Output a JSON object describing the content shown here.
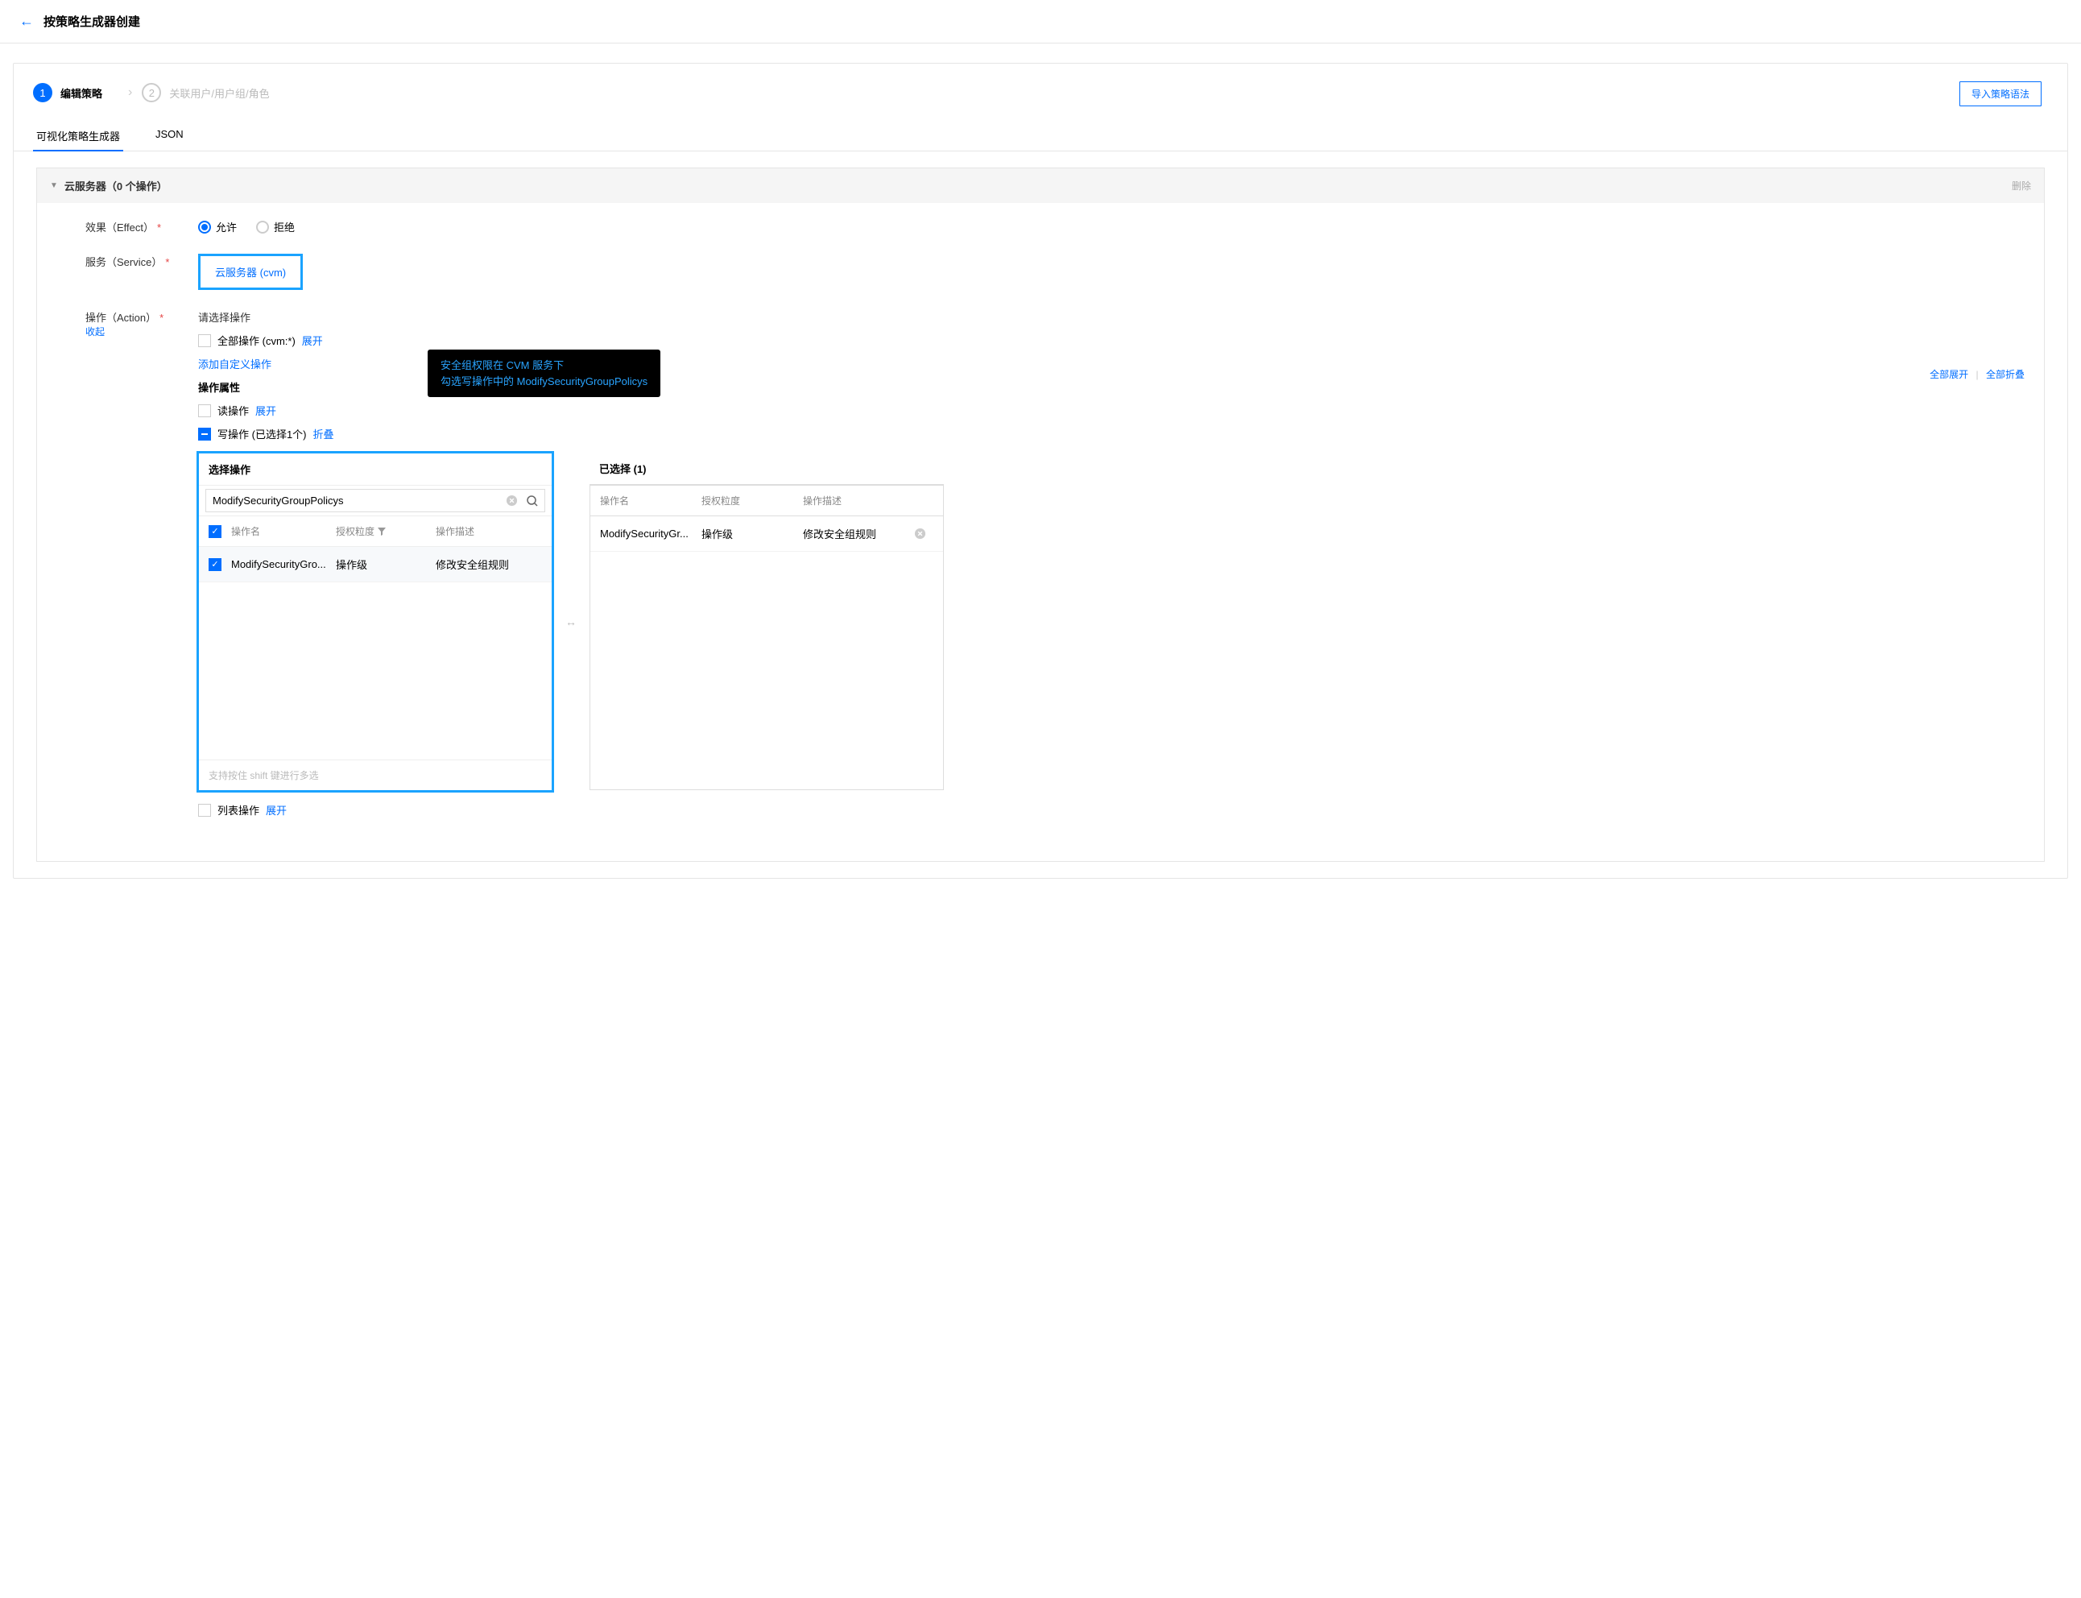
{
  "header": {
    "title": "按策略生成器创建"
  },
  "steps": {
    "step1_num": "1",
    "step1_label": "编辑策略",
    "step2_num": "2",
    "step2_label": "关联用户/用户组/角色",
    "import_btn": "导入策略语法"
  },
  "tabs": {
    "visual": "可视化策略生成器",
    "json": "JSON"
  },
  "section": {
    "title": "云服务器（0 个操作）",
    "delete": "删除"
  },
  "effect": {
    "label": "效果（Effect）",
    "allow": "允许",
    "deny": "拒绝"
  },
  "service": {
    "label": "服务（Service）",
    "value": "云服务器 (cvm)"
  },
  "action": {
    "label": "操作（Action）",
    "collapse": "收起",
    "select_hint": "请选择操作",
    "all_ops": "全部操作 (cvm:*)",
    "expand": "展开",
    "add_custom": "添加自定义操作",
    "attr_label": "操作属性",
    "expand_all": "全部展开",
    "collapse_all": "全部折叠",
    "read_ops": "读操作",
    "write_ops": "写操作 (已选择1个)",
    "collapse_link": "折叠",
    "list_ops": "列表操作"
  },
  "tooltip": {
    "line1": "安全组权限在 CVM 服务下",
    "line2": "勾选写操作中的 ModifySecurityGroupPolicys"
  },
  "left_panel": {
    "title": "选择操作",
    "search_value": "ModifySecurityGroupPolicys",
    "col_name": "操作名",
    "col_grain": "授权粒度",
    "col_desc": "操作描述",
    "row": {
      "name": "ModifySecurityGro...",
      "grain": "操作级",
      "desc": "修改安全组规则"
    },
    "footer": "支持按住 shift 键进行多选"
  },
  "right_panel": {
    "title": "已选择 (1)",
    "col_name": "操作名",
    "col_grain": "授权粒度",
    "col_desc": "操作描述",
    "row": {
      "name": "ModifySecurityGr...",
      "grain": "操作级",
      "desc": "修改安全组规则"
    }
  }
}
